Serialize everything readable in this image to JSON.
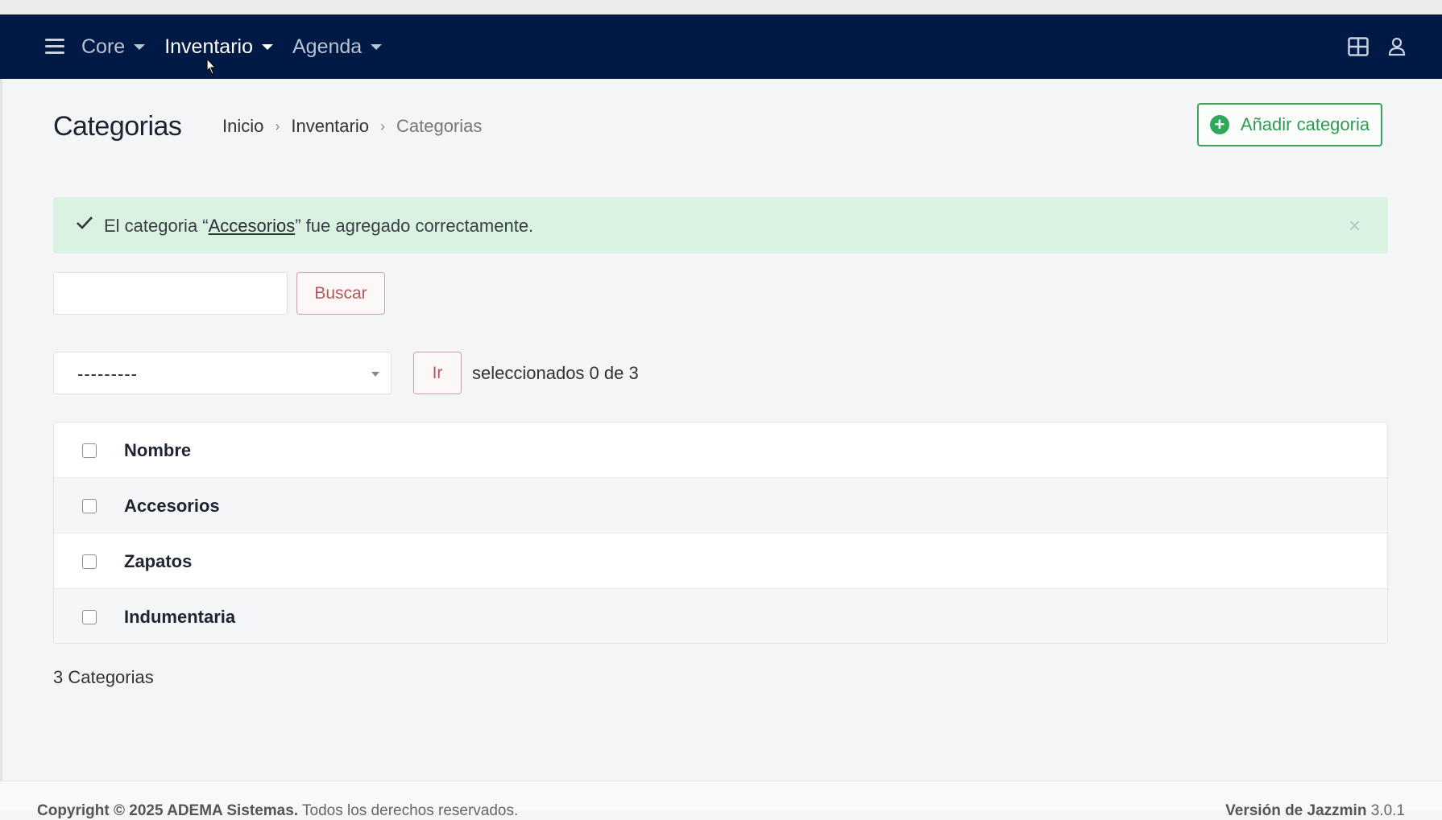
{
  "navbar": {
    "menu": [
      {
        "label": "Core",
        "active": false
      },
      {
        "label": "Inventario",
        "active": true
      },
      {
        "label": "Agenda",
        "active": false
      }
    ],
    "icons": [
      "menu-icon",
      "grid-icon",
      "user-icon"
    ]
  },
  "header": {
    "title": "Categorias",
    "breadcrumb": [
      "Inicio",
      "Inventario",
      "Categorias"
    ],
    "add_button": "Añadir categoria"
  },
  "alert": {
    "prefix": "El categoria “",
    "link": "Accesorios",
    "suffix": "” fue agregado correctamente.",
    "close": "×"
  },
  "search": {
    "value": "",
    "button": "Buscar"
  },
  "actions": {
    "selected_value": "---------",
    "go_button": "Ir",
    "count_text": "seleccionados 0 de 3"
  },
  "table": {
    "header": "Nombre",
    "rows": [
      "Accesorios",
      "Zapatos",
      "Indumentaria"
    ]
  },
  "total": "3 Categorias",
  "footer": {
    "copyright_bold": "Copyright © 2025 ADEMA Sistemas.",
    "copyright_rest": " Todos los derechos reservados.",
    "version_label": "Versión de Jazzmin",
    "version_value": " 3.0.1"
  },
  "colors": {
    "navbar": "#001a45",
    "success": "#2fa85a",
    "alert_bg": "#d9f2e2",
    "danger_text": "#b3585b"
  }
}
